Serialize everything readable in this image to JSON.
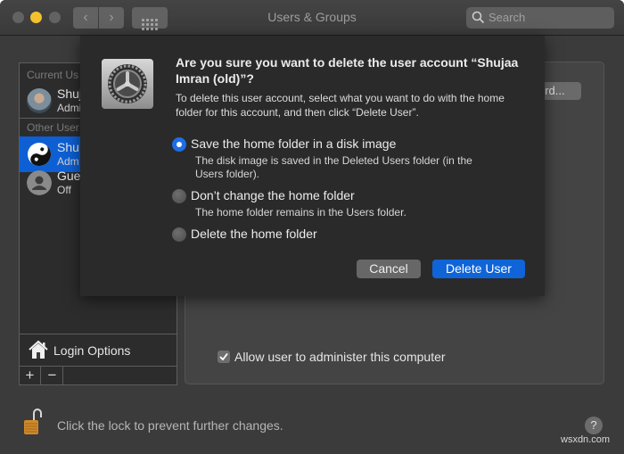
{
  "window": {
    "title": "Users & Groups",
    "search_placeholder": "Search",
    "nav": {
      "back": "‹",
      "forward": "›"
    }
  },
  "sidebar": {
    "current_users_header": "Current Us",
    "other_users_header": "Other User",
    "users": [
      {
        "name": "Shuj",
        "role": "Admi",
        "avatar": "photo-avatar",
        "selected": false
      },
      {
        "name": "Shu",
        "role": "Adm",
        "avatar": "yin-yang-avatar",
        "selected": true
      },
      {
        "name": "Gue",
        "role": "Off",
        "avatar": "guest-avatar",
        "selected": false
      }
    ],
    "login_options": "Login Options",
    "add": "+",
    "remove": "−"
  },
  "panel": {
    "password_button": "ord...",
    "admin_checkbox_label": "Allow user to administer this computer",
    "admin_checked": true
  },
  "footer": {
    "lock_text": "Click the lock to prevent further changes.",
    "help": "?",
    "watermark": "wsxdn.com"
  },
  "dialog": {
    "title": "Are you sure you want to delete the user account “Shujaa Imran (old)”?",
    "description": "To delete this user account, select what you want to do with the home folder for this account, and then click “Delete User”.",
    "options": [
      {
        "label": "Save the home folder in a disk image",
        "sub": "The disk image is saved in the Deleted Users folder (in the Users folder).",
        "selected": true
      },
      {
        "label": "Don’t change the home folder",
        "sub": "The home folder remains in the Users folder.",
        "selected": false
      },
      {
        "label": "Delete the home folder",
        "sub": "",
        "selected": false
      }
    ],
    "cancel": "Cancel",
    "confirm": "Delete User",
    "accent_color": "#0f64d8"
  }
}
